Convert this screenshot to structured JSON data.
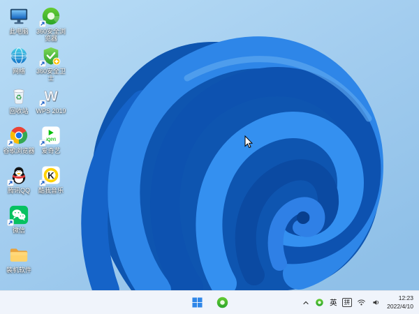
{
  "colors": {
    "wallpaper_sky": "#a7cfee",
    "bloom_primary": "#1563c8",
    "bloom_dark": "#0b4aa2",
    "bloom_light": "#3490f0",
    "taskbar_bg": "#f2f6fb",
    "icon_label_text": "#ffffff"
  },
  "desktop": {
    "icons": [
      {
        "label": "此电脑",
        "name": "this-pc",
        "shortcut": false
      },
      {
        "label": "360安全浏览器",
        "name": "360-secure-browser",
        "shortcut": true
      },
      {
        "label": "网络",
        "name": "network",
        "shortcut": false
      },
      {
        "label": "360安全卫士",
        "name": "360-safety-guard",
        "shortcut": true
      },
      {
        "label": "回收站",
        "name": "recycle-bin",
        "shortcut": false
      },
      {
        "label": "WPS 2019",
        "name": "wps-2019",
        "shortcut": true
      },
      {
        "label": "谷歌浏览器",
        "name": "google-chrome",
        "shortcut": true
      },
      {
        "label": "爱奇艺",
        "name": "iqiyi",
        "shortcut": true
      },
      {
        "label": "腾讯QQ",
        "name": "tencent-qq",
        "shortcut": true
      },
      {
        "label": "酷我音乐",
        "name": "kuwo-music",
        "shortcut": true
      },
      {
        "label": "微信",
        "name": "wechat",
        "shortcut": true
      },
      {
        "label": "装机软件",
        "name": "software-folder",
        "shortcut": false
      }
    ]
  },
  "taskbar": {
    "pinned": [
      {
        "name": "start"
      },
      {
        "name": "360-secure-browser"
      }
    ],
    "tray": {
      "ime_mode": "英",
      "ime_scheme": "拼",
      "time": "12:23",
      "date": "2022/4/10"
    }
  }
}
